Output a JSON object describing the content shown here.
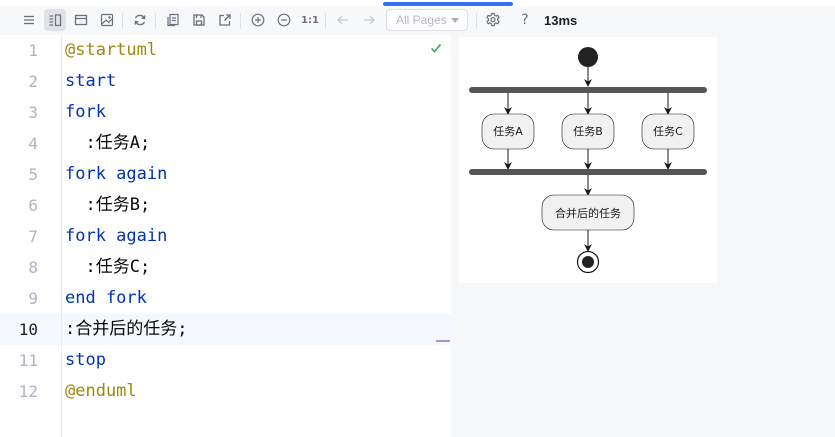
{
  "toolbar": {
    "pages_select": "All Pages",
    "zoom_actual": "1:1",
    "help": "?",
    "render_time": "13ms"
  },
  "editor": {
    "lines": [
      {
        "no": "1",
        "text": "@startuml"
      },
      {
        "no": "2",
        "text": "start"
      },
      {
        "no": "3",
        "text": "fork"
      },
      {
        "no": "4",
        "text": "  :任务A;"
      },
      {
        "no": "5",
        "text": "fork again"
      },
      {
        "no": "6",
        "text": "  :任务B;"
      },
      {
        "no": "7",
        "text": "fork again"
      },
      {
        "no": "8",
        "text": "  :任务C;"
      },
      {
        "no": "9",
        "text": "end fork"
      },
      {
        "no": "10",
        "text": ":合并后的任务;"
      },
      {
        "no": "11",
        "text": "stop"
      },
      {
        "no": "12",
        "text": "@enduml"
      }
    ],
    "current_line": "10"
  },
  "diagram": {
    "activities": [
      "任务A",
      "任务B",
      "任务C"
    ],
    "merged_activity": "合并后的任务"
  },
  "colors": {
    "keyword": "#0033b3",
    "meta": "#9e880d",
    "check": "#59a869",
    "accent": "#3574f0"
  }
}
